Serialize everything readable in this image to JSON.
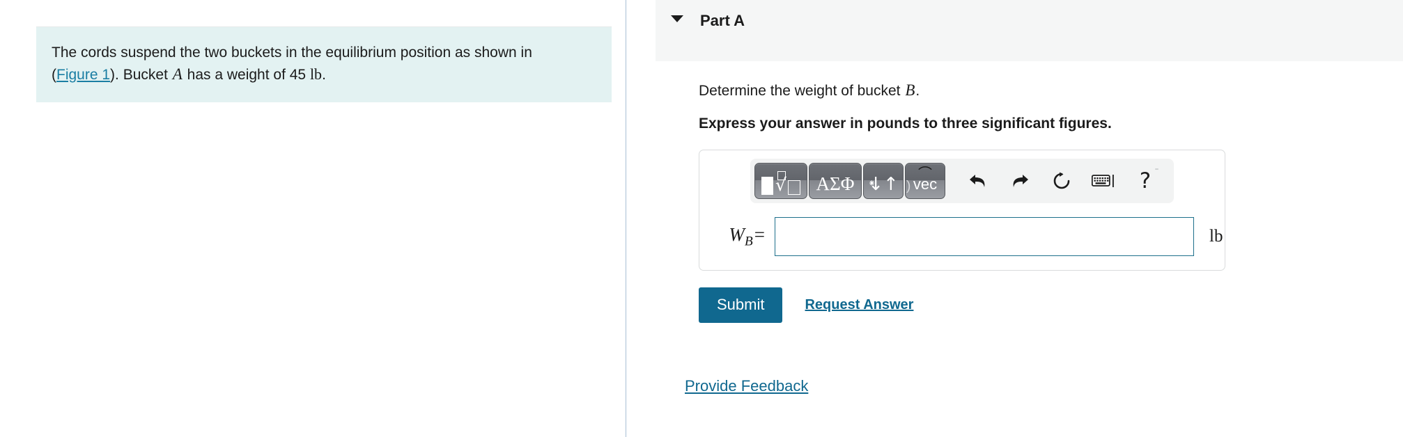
{
  "left_panel": {
    "problem_statement": {
      "part1": "The cords suspend the two buckets in the equilibrium position as shown in",
      "open_paren": "(",
      "figure_link": "Figure 1",
      "part2": "). Bucket ",
      "bucket_var": "A",
      "part3": " has a weight of 45 ",
      "unit": "lb",
      "period": "."
    }
  },
  "right_panel": {
    "part_header": {
      "title": "Part A",
      "toggle_icon": "caret-down-icon"
    },
    "question": {
      "prompt_prefix": "Determine the weight of bucket ",
      "prompt_var": "B",
      "prompt_suffix": ".",
      "instruction": "Express your answer in pounds to three significant figures."
    },
    "math_toolbar": {
      "buttons": [
        {
          "name": "template-palette-button",
          "icon": "math-template-icon",
          "label": ""
        },
        {
          "name": "greek-palette-button",
          "icon": "greek-letters-icon",
          "label": "ΑΣΦ"
        },
        {
          "name": "arrows-palette-button",
          "icon": "up-down-arrows-icon",
          "label": "↓↑"
        },
        {
          "name": "vector-palette-button",
          "icon": "vector-icon",
          "label": "vec"
        }
      ],
      "tools": [
        {
          "name": "undo-button",
          "icon": "undo-arrow-icon",
          "glyph": "↰"
        },
        {
          "name": "redo-button",
          "icon": "redo-arrow-icon",
          "glyph": "↱"
        },
        {
          "name": "reset-button",
          "icon": "circular-reset-arrow-icon",
          "glyph": "↻"
        },
        {
          "name": "keyboard-button",
          "icon": "keyboard-icon",
          "glyph": "⌨"
        },
        {
          "name": "help-button",
          "icon": "question-mark-icon",
          "glyph": "?"
        }
      ]
    },
    "answer": {
      "label_var": "W",
      "label_sub": "B",
      "label_eq": "=",
      "value": "",
      "placeholder": "",
      "unit": "lb"
    },
    "actions": {
      "submit_label": "Submit",
      "request_answer_label": "Request Answer"
    },
    "feedback_link": "Provide Feedback"
  },
  "colors": {
    "statement_background": "#e3f2f2",
    "link": "#10688f",
    "figure_link": "#1a7ea3",
    "submit_background": "#10688f",
    "part_header_background": "#f5f6f6",
    "input_border": "#1d6f8b",
    "divider": "#a8bfd4"
  }
}
